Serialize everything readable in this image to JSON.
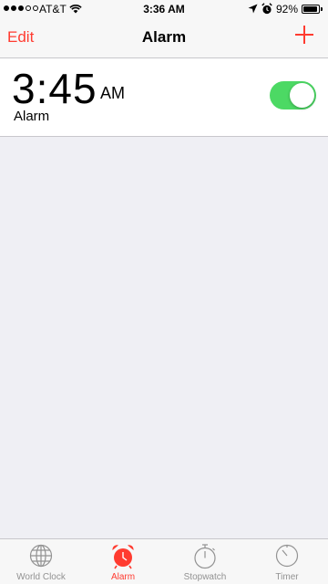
{
  "status_bar": {
    "carrier": "AT&T",
    "time": "3:36 AM",
    "battery": "92%",
    "battery_level": 0.92,
    "signal_bars_filled": 3,
    "signal_bars_total": 5
  },
  "nav": {
    "edit_label": "Edit",
    "title": "Alarm",
    "add_icon": "plus-icon"
  },
  "alarms": [
    {
      "time": "3:45",
      "ampm": "AM",
      "label": "Alarm",
      "enabled": true
    }
  ],
  "tabs": [
    {
      "label": "World Clock",
      "icon": "globe-icon",
      "active": false
    },
    {
      "label": "Alarm",
      "icon": "alarm-clock-icon",
      "active": true
    },
    {
      "label": "Stopwatch",
      "icon": "stopwatch-icon",
      "active": false
    },
    {
      "label": "Timer",
      "icon": "timer-icon",
      "active": false
    }
  ],
  "colors": {
    "accent": "#ff3b30",
    "toggle_on": "#4cd964",
    "background": "#efeff4",
    "tab_inactive": "#929292"
  }
}
